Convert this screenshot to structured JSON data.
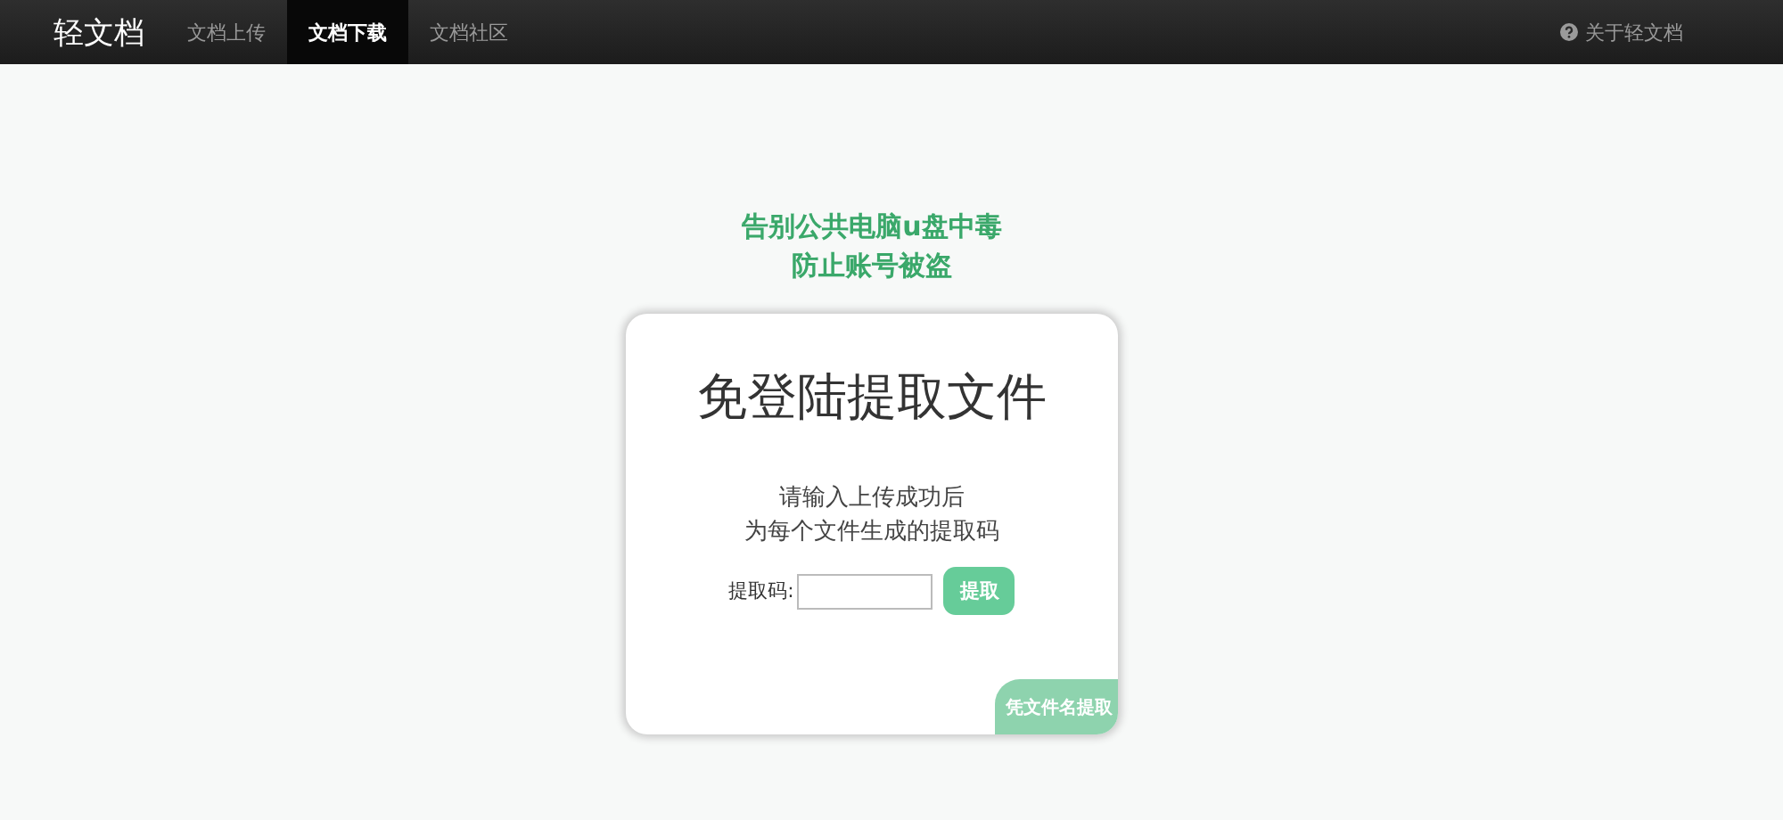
{
  "navbar": {
    "brand": "轻文档",
    "tabs": [
      {
        "label": "文档上传",
        "selected": false
      },
      {
        "label": "文档下载",
        "selected": true
      },
      {
        "label": "文档社区",
        "selected": false
      }
    ],
    "about": "关于轻文档"
  },
  "slogan": [
    "告别公共电脑u盘中毒",
    "防止账号被盗"
  ],
  "card": {
    "title": "免登陆提取文件",
    "description": [
      "请输入上传成功后",
      "为每个文件生成的提取码"
    ],
    "code_label": "提取码:",
    "submit": "提取",
    "corner_link": "凭文件名提取"
  }
}
